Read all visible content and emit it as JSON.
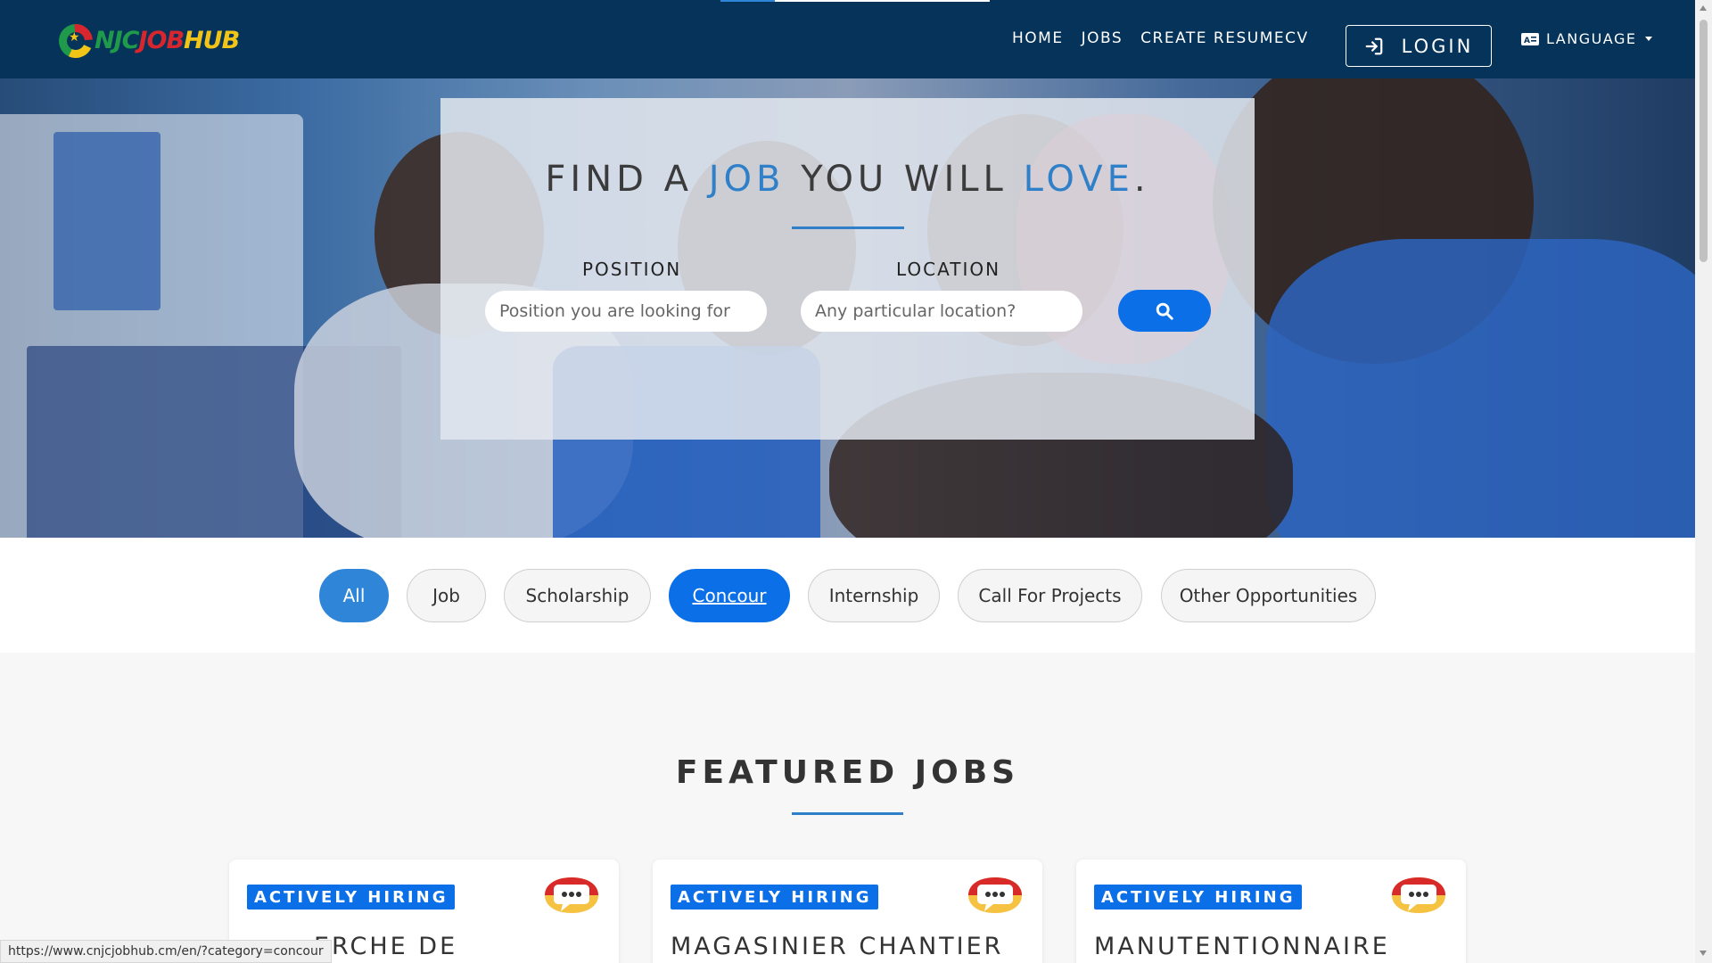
{
  "brand": {
    "logo_text_part1": "NJC",
    "logo_text_part2": "JOB",
    "logo_text_part3": "HUB",
    "colors": {
      "green": "#1f9a4a",
      "red": "#d7262e",
      "yellow": "#f2c417"
    }
  },
  "nav": {
    "links": [
      "HOME",
      "JOBS",
      "CREATE RESUMECV"
    ],
    "login_label": "LOGIN",
    "login_icon": "sign-in-icon",
    "language_label": "LANGUAGE",
    "language_icon": "language-icon",
    "background": "#053359"
  },
  "hero": {
    "title_part1": "FIND A ",
    "title_highlight1": "JOB",
    "title_part2": " YOU WILL ",
    "title_highlight2": "LOVE",
    "title_part3": ".",
    "position_label": "POSITION",
    "position_placeholder": "Position you are looking for",
    "location_label": "LOCATION",
    "location_placeholder": "Any particular location?",
    "search_icon": "search-icon",
    "accent": "#2f80c8"
  },
  "categories": {
    "items": [
      "All",
      "Job",
      "Scholarship",
      "Concour",
      "Internship",
      "Call For Projects",
      "Other Opportunities"
    ],
    "active": "Concour"
  },
  "featured": {
    "title": "FEATURED JOBS",
    "jobs": [
      {
        "badge": "ACTIVELY HIRING",
        "title": "ERCHE DE"
      },
      {
        "badge": "ACTIVELY HIRING",
        "title": "MAGASINIER CHANTIER"
      },
      {
        "badge": "ACTIVELY HIRING",
        "title": "MANUTENTIONNAIRE"
      }
    ]
  },
  "status_bar": {
    "url": "https://www.cnjcjobhub.cm/en/?category=concour"
  }
}
